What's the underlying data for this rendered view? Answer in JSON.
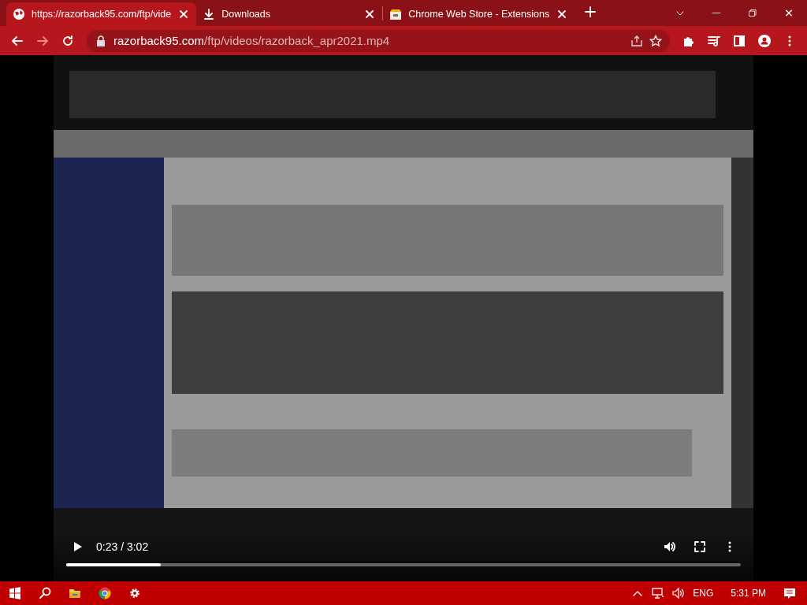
{
  "tabs": [
    {
      "title": "https://razorback95.com/ftp/vide",
      "selected": true
    },
    {
      "title": "Downloads",
      "selected": false
    },
    {
      "title": "Chrome Web Store - Extensions",
      "selected": false
    }
  ],
  "address_bar": {
    "host": "razorback95.com",
    "path": "/ftp/videos/razorback_apr2021.mp4"
  },
  "video": {
    "kind": "picture",
    "time": "0:23 / 3:02",
    "progress": {
      "level": 0.14
    }
  },
  "taskbar": {
    "language": "ENG",
    "clock": "5:31 PM"
  }
}
